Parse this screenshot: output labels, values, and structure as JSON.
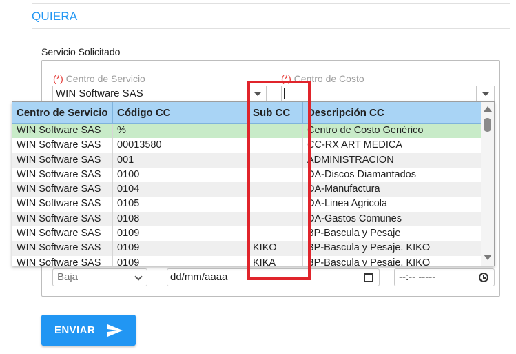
{
  "header": {
    "title": "QUIERA"
  },
  "form": {
    "legend": "Servicio Solicitado",
    "required_mark": "(*)",
    "centro_servicio": {
      "label": "Centro de Servicio",
      "value": "WIN Software SAS"
    },
    "centro_costo": {
      "label": "Centro de Costo",
      "value": ""
    },
    "priority_select": {
      "value": "Baja"
    },
    "date_input": {
      "placeholder": "dd/mm/aaaa"
    },
    "time_input": {
      "placeholder": "--:-- -----"
    },
    "submit_label": "ENVIAR"
  },
  "dropdown": {
    "columns": [
      "Centro de Servicio",
      "Código CC",
      "Sub CC",
      "Descripción CC"
    ],
    "rows": [
      [
        "WIN Software SAS",
        "%",
        "",
        "Centro de Costo Genérico"
      ],
      [
        "WIN Software SAS",
        "00013580",
        "",
        "CC-RX ART MEDICA"
      ],
      [
        "WIN Software SAS",
        "001",
        "",
        "ADMINISTRACION"
      ],
      [
        "WIN Software SAS",
        "0100",
        "",
        "DA-Discos Diamantados"
      ],
      [
        "WIN Software SAS",
        "0104",
        "",
        "DA-Manufactura"
      ],
      [
        "WIN Software SAS",
        "0105",
        "",
        "DA-Linea Agricola"
      ],
      [
        "WIN Software SAS",
        "0108",
        "",
        "DA-Gastos Comunes"
      ],
      [
        "WIN Software SAS",
        "0109",
        "",
        "BP-Bascula y Pesaje"
      ],
      [
        "WIN Software SAS",
        "0109",
        "KIKO",
        "BP-Bascula y Pesaje. KIKO"
      ],
      [
        "WIN Software SAS",
        "0109",
        "KIKA",
        "BP-Bascula y Pesaje. KIKO"
      ]
    ]
  },
  "colors": {
    "accent": "#2196f3",
    "header_row": "#a9d4f5",
    "selected_row": "#c8ebc8",
    "highlight": "#e0242b",
    "required": "#e53935"
  }
}
